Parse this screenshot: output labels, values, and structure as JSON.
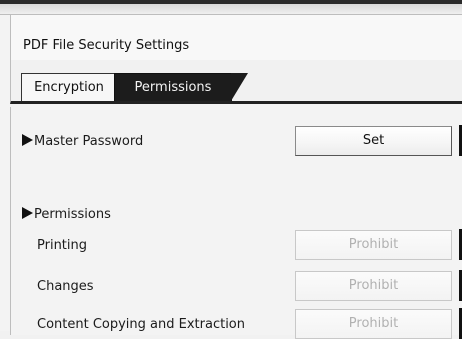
{
  "window": {
    "title": "PDF File Security Settings"
  },
  "tabs": [
    {
      "label": "Encryption",
      "selected": false
    },
    {
      "label": "Permissions",
      "selected": true
    }
  ],
  "master_password": {
    "label": "Master Password",
    "button_label": "Set"
  },
  "permissions": {
    "heading": "Permissions",
    "items": [
      {
        "label": "Printing",
        "button_label": "Prohibit",
        "enabled": false
      },
      {
        "label": "Changes",
        "button_label": "Prohibit",
        "enabled": false
      },
      {
        "label": "Content Copying and Extraction",
        "button_label": "Prohibit",
        "enabled": false
      }
    ]
  },
  "colors": {
    "selected_tab_bg": "#1c1c1c",
    "disabled_text": "#b1b1b1",
    "accent_dark": "#111111"
  }
}
